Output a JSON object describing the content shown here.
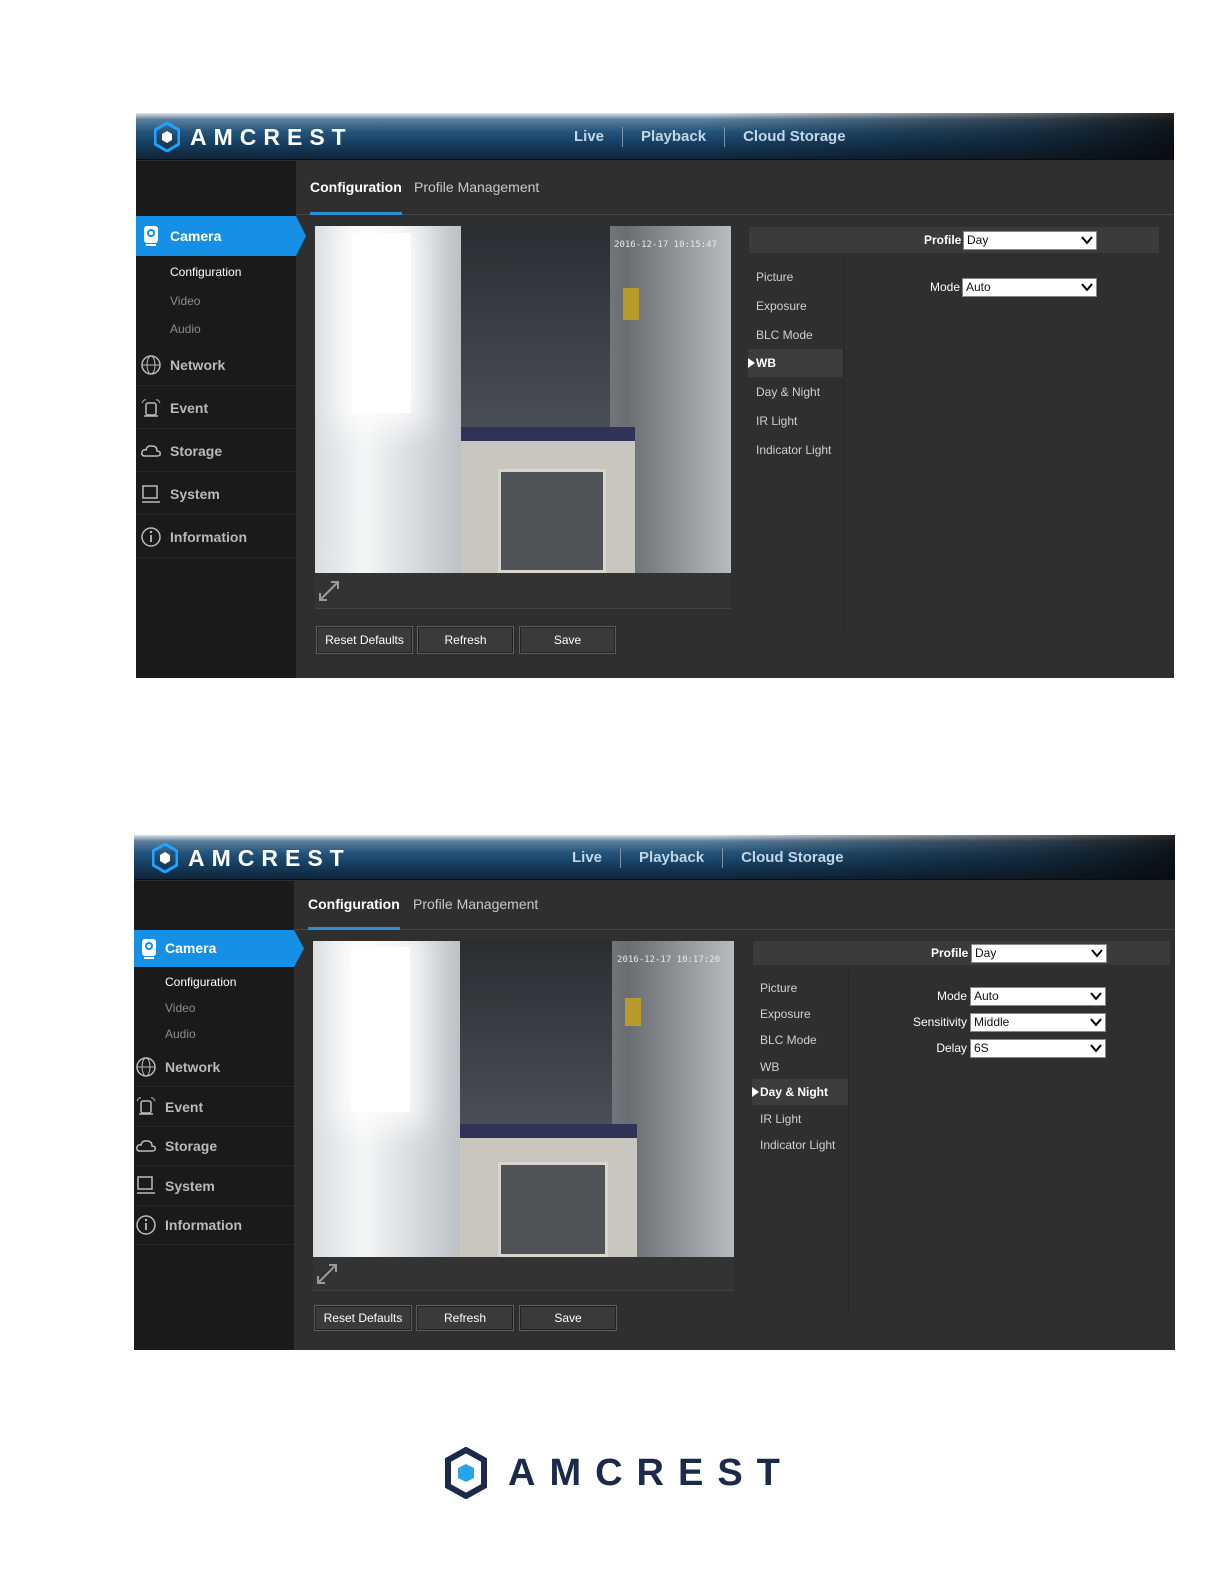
{
  "app": {
    "brand": "AMCREST"
  },
  "nav": [
    "Live",
    "Playback",
    "Cloud Storage"
  ],
  "tabs": [
    "Configuration",
    "Profile Management"
  ],
  "sidebar": {
    "camera": "Camera",
    "camera_sub": [
      "Configuration",
      "Video",
      "Audio"
    ],
    "items": [
      "Network",
      "Event",
      "Storage",
      "System",
      "Information"
    ]
  },
  "submenu": [
    "Picture",
    "Exposure",
    "BLC Mode",
    "WB",
    "Day & Night",
    "IR Light",
    "Indicator Light"
  ],
  "buttons": {
    "reset": "Reset Defaults",
    "refresh": "Refresh",
    "save": "Save"
  },
  "screens": [
    {
      "active_submenu": "WB",
      "timestamp": "2016-12-17 10:15:47",
      "camera_tag": "PC",
      "fields": {
        "profile_label": "Profile",
        "profile_value": "Day",
        "mode_label": "Mode",
        "mode_value": "Auto"
      }
    },
    {
      "active_submenu": "Day & Night",
      "timestamp": "2016-12-17 10:17:20",
      "camera_tag": "PC",
      "fields": {
        "profile_label": "Profile",
        "profile_value": "Day",
        "mode_label": "Mode",
        "mode_value": "Auto",
        "sensitivity_label": "Sensitivity",
        "sensitivity_value": "Middle",
        "delay_label": "Delay",
        "delay_value": "6S"
      }
    }
  ],
  "colors": {
    "accent": "#1690e6",
    "sidebar": "#1a1a1a",
    "content": "#2f2f2f",
    "footer_brand": "#1b2a4a"
  }
}
